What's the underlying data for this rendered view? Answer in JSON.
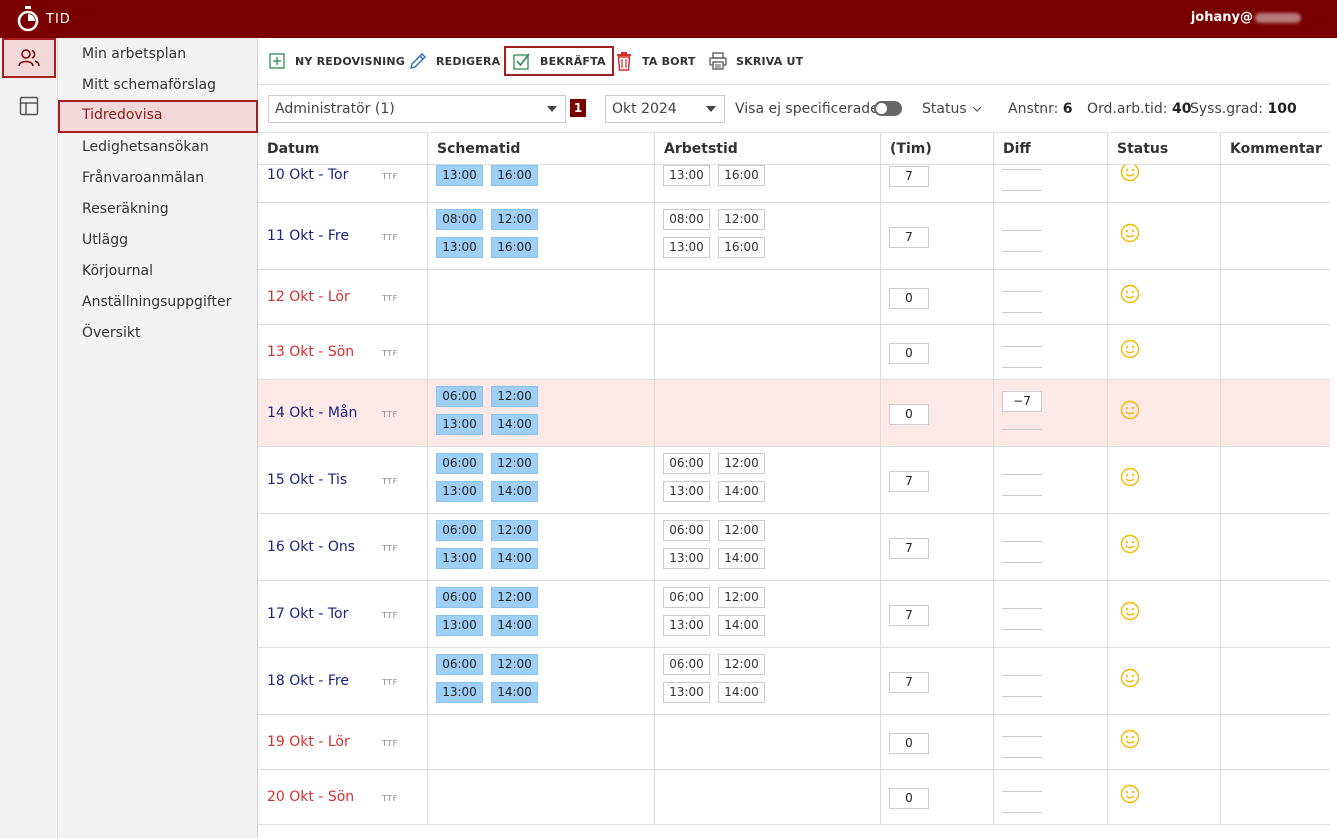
{
  "app": {
    "title": "TID",
    "user": "johany@"
  },
  "nav": {
    "items": [
      {
        "label": "Min arbetsplan"
      },
      {
        "label": "Mitt schemaförslag"
      },
      {
        "label": "Tidredovisa"
      },
      {
        "label": "Ledighetsansökan"
      },
      {
        "label": "Frånvaroanmälan"
      },
      {
        "label": "Reseräkning"
      },
      {
        "label": "Utlägg"
      },
      {
        "label": "Körjournal"
      },
      {
        "label": "Anställningsuppgifter"
      },
      {
        "label": "Översikt"
      }
    ],
    "active": "Tidredovisa"
  },
  "toolbar": {
    "new_label": "NY REDOVISNING",
    "edit_label": "REDIGERA",
    "confirm_label": "BEKRÄFTA",
    "delete_label": "TA BORT",
    "print_label": "SKRIVA UT"
  },
  "filters": {
    "role_value": "Administratör (1)",
    "badge": "1",
    "month_value": "Okt 2024",
    "unspecified_label": "Visa ej specificerade",
    "status_label": "Status",
    "anstnr_label": "Anstnr:",
    "anstnr_value": "6",
    "ordarb_label": "Ord.arb.tid:",
    "ordarb_value": "40",
    "syss_label": "Syss.grad:",
    "syss_value": "100"
  },
  "table": {
    "headers": {
      "date": "Datum",
      "schedule": "Schematid",
      "work": "Arbetstid",
      "hours": "(Tim)",
      "diff": "Diff",
      "status": "Status",
      "comment": "Kommentar"
    },
    "ttf": "TTF",
    "rows": [
      {
        "date": "10 Okt - Tor",
        "weekend": false,
        "highlight": false,
        "sched": [
          "13:00",
          "16:00"
        ],
        "work": [
          "13:00",
          "16:00"
        ],
        "hours": "7",
        "diff": ""
      },
      {
        "date": "11 Okt - Fre",
        "weekend": false,
        "highlight": false,
        "sched": [
          "08:00",
          "12:00",
          "13:00",
          "16:00"
        ],
        "work": [
          "08:00",
          "12:00",
          "13:00",
          "16:00"
        ],
        "hours": "7",
        "diff": ""
      },
      {
        "date": "12 Okt - Lör",
        "weekend": true,
        "highlight": false,
        "sched": [],
        "work": [],
        "hours": "0",
        "diff": ""
      },
      {
        "date": "13 Okt - Sön",
        "weekend": true,
        "highlight": false,
        "sched": [],
        "work": [],
        "hours": "0",
        "diff": ""
      },
      {
        "date": "14 Okt - Mån",
        "weekend": false,
        "highlight": true,
        "sched": [
          "06:00",
          "12:00",
          "13:00",
          "14:00"
        ],
        "work": [],
        "hours": "0",
        "diff": "−7"
      },
      {
        "date": "15 Okt - Tis",
        "weekend": false,
        "highlight": false,
        "sched": [
          "06:00",
          "12:00",
          "13:00",
          "14:00"
        ],
        "work": [
          "06:00",
          "12:00",
          "13:00",
          "14:00"
        ],
        "hours": "7",
        "diff": ""
      },
      {
        "date": "16 Okt - Ons",
        "weekend": false,
        "highlight": false,
        "sched": [
          "06:00",
          "12:00",
          "13:00",
          "14:00"
        ],
        "work": [
          "06:00",
          "12:00",
          "13:00",
          "14:00"
        ],
        "hours": "7",
        "diff": ""
      },
      {
        "date": "17 Okt - Tor",
        "weekend": false,
        "highlight": false,
        "sched": [
          "06:00",
          "12:00",
          "13:00",
          "14:00"
        ],
        "work": [
          "06:00",
          "12:00",
          "13:00",
          "14:00"
        ],
        "hours": "7",
        "diff": ""
      },
      {
        "date": "18 Okt - Fre",
        "weekend": false,
        "highlight": false,
        "sched": [
          "06:00",
          "12:00",
          "13:00",
          "14:00"
        ],
        "work": [
          "06:00",
          "12:00",
          "13:00",
          "14:00"
        ],
        "hours": "7",
        "diff": ""
      },
      {
        "date": "19 Okt - Lör",
        "weekend": true,
        "highlight": false,
        "sched": [],
        "work": [],
        "hours": "0",
        "diff": ""
      },
      {
        "date": "20 Okt - Sön",
        "weekend": true,
        "highlight": false,
        "sched": [],
        "work": [],
        "hours": "0",
        "diff": ""
      }
    ]
  },
  "colors": {
    "brand": "#7a0000",
    "schedule_fill": "#9ed0f7",
    "weekend_text": "#d32f2f",
    "weekday_text": "#1a237e",
    "highlight_row": "#fde8e8",
    "smiley": "#f5b800"
  },
  "icons": {
    "logo": "stopwatch-icon",
    "rail_people": "people-icon",
    "rail_layout": "layout-icon",
    "new": "plus-square-icon",
    "edit": "pencil-icon",
    "confirm": "check-square-icon",
    "delete": "trash-icon",
    "print": "printer-icon",
    "status": "smiley-icon"
  }
}
